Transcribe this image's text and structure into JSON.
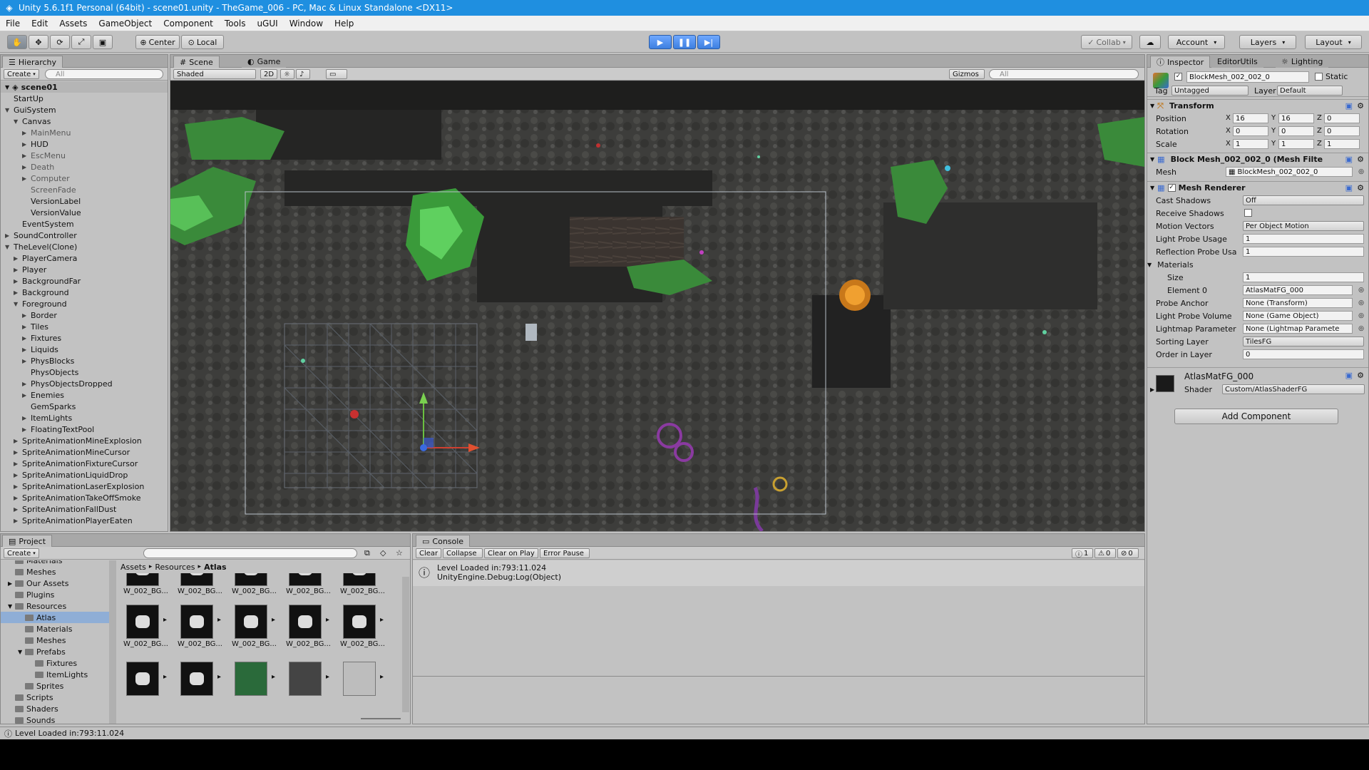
{
  "titlebar": {
    "title": "Unity 5.6.1f1 Personal (64bit) - scene01.unity - TheGame_006 - PC, Mac & Linux Standalone <DX11>"
  },
  "menu": [
    "File",
    "Edit",
    "Assets",
    "GameObject",
    "Component",
    "Tools",
    "uGUI",
    "Window",
    "Help"
  ],
  "toolbar": {
    "center": "Center",
    "local": "Local",
    "collab": "Collab",
    "account": "Account",
    "layers": "Layers",
    "layout": "Layout"
  },
  "hierarchy": {
    "tab": "Hierarchy",
    "create": "Create",
    "search": "All",
    "scene": "scene01",
    "items": [
      {
        "label": "StartUp",
        "depth": 1,
        "arrow": ""
      },
      {
        "label": "GuiSystem",
        "depth": 1,
        "arrow": "down"
      },
      {
        "label": "Canvas",
        "depth": 2,
        "arrow": "down"
      },
      {
        "label": "MainMenu",
        "depth": 3,
        "arrow": "right",
        "dim": true
      },
      {
        "label": "HUD",
        "depth": 3,
        "arrow": "right"
      },
      {
        "label": "EscMenu",
        "depth": 3,
        "arrow": "right",
        "dim": true
      },
      {
        "label": "Death",
        "depth": 3,
        "arrow": "right",
        "dim": true
      },
      {
        "label": "Computer",
        "depth": 3,
        "arrow": "right",
        "dim": true
      },
      {
        "label": "ScreenFade",
        "depth": 3,
        "arrow": "",
        "dim": true
      },
      {
        "label": "VersionLabel",
        "depth": 3,
        "arrow": ""
      },
      {
        "label": "VersionValue",
        "depth": 3,
        "arrow": ""
      },
      {
        "label": "EventSystem",
        "depth": 2,
        "arrow": ""
      },
      {
        "label": "SoundController",
        "depth": 1,
        "arrow": "right"
      },
      {
        "label": "TheLevel(Clone)",
        "depth": 1,
        "arrow": "down"
      },
      {
        "label": "PlayerCamera",
        "depth": 2,
        "arrow": "right"
      },
      {
        "label": "Player",
        "depth": 2,
        "arrow": "right"
      },
      {
        "label": "BackgroundFar",
        "depth": 2,
        "arrow": "right"
      },
      {
        "label": "Background",
        "depth": 2,
        "arrow": "right"
      },
      {
        "label": "Foreground",
        "depth": 2,
        "arrow": "down"
      },
      {
        "label": "Border",
        "depth": 3,
        "arrow": "right"
      },
      {
        "label": "Tiles",
        "depth": 3,
        "arrow": "right"
      },
      {
        "label": "Fixtures",
        "depth": 3,
        "arrow": "right"
      },
      {
        "label": "Liquids",
        "depth": 3,
        "arrow": "right"
      },
      {
        "label": "PhysBlocks",
        "depth": 3,
        "arrow": "right"
      },
      {
        "label": "PhysObjects",
        "depth": 3,
        "arrow": ""
      },
      {
        "label": "PhysObjectsDropped",
        "depth": 3,
        "arrow": "right"
      },
      {
        "label": "Enemies",
        "depth": 3,
        "arrow": "right"
      },
      {
        "label": "GemSparks",
        "depth": 3,
        "arrow": ""
      },
      {
        "label": "ItemLights",
        "depth": 3,
        "arrow": "right"
      },
      {
        "label": "FloatingTextPool",
        "depth": 3,
        "arrow": "right"
      },
      {
        "label": "SpriteAnimationMineExplosion",
        "depth": 2,
        "arrow": "right"
      },
      {
        "label": "SpriteAnimationMineCursor",
        "depth": 2,
        "arrow": "right"
      },
      {
        "label": "SpriteAnimationFixtureCursor",
        "depth": 2,
        "arrow": "right"
      },
      {
        "label": "SpriteAnimationLiquidDrop",
        "depth": 2,
        "arrow": "right"
      },
      {
        "label": "SpriteAnimationLaserExplosion",
        "depth": 2,
        "arrow": "right"
      },
      {
        "label": "SpriteAnimationTakeOffSmoke",
        "depth": 2,
        "arrow": "right"
      },
      {
        "label": "SpriteAnimationFallDust",
        "depth": 2,
        "arrow": "right"
      },
      {
        "label": "SpriteAnimationPlayerEaten",
        "depth": 2,
        "arrow": "right"
      }
    ]
  },
  "scene": {
    "tab_scene": "Scene",
    "tab_game": "Game",
    "shading": "Shaded",
    "mode2d": "2D",
    "gizmos": "Gizmos",
    "search": "All"
  },
  "inspector": {
    "tabs": [
      "Inspector",
      "EditorUtils",
      "Lighting"
    ],
    "object_name": "BlockMesh_002_002_0",
    "static": "Static",
    "tag_label": "Tag",
    "tag": "Untagged",
    "layer_label": "Layer",
    "layer": "Default",
    "transform": {
      "title": "Transform",
      "rows": [
        {
          "label": "Position",
          "x": "16",
          "y": "16",
          "z": "0"
        },
        {
          "label": "Rotation",
          "x": "0",
          "y": "0",
          "z": "0"
        },
        {
          "label": "Scale",
          "x": "1",
          "y": "1",
          "z": "1"
        }
      ]
    },
    "meshfilter": {
      "title": "Block Mesh_002_002_0 (Mesh Filte",
      "mesh_label": "Mesh",
      "mesh": "BlockMesh_002_002_0"
    },
    "renderer": {
      "title": "Mesh Renderer",
      "rows": [
        {
          "label": "Cast Shadows",
          "value": "Off",
          "kind": "dd"
        },
        {
          "label": "Receive Shadows",
          "value": "",
          "kind": "check"
        },
        {
          "label": "Motion Vectors",
          "value": "Per Object Motion",
          "kind": "dd"
        },
        {
          "label": "Light Probe Usage",
          "value": "1",
          "kind": "field"
        },
        {
          "label": "Reflection Probe Usa",
          "value": "1",
          "kind": "field"
        },
        {
          "label": "Materials",
          "value": "",
          "kind": "header"
        },
        {
          "label": "Size",
          "value": "1",
          "kind": "field",
          "indent": 1
        },
        {
          "label": "Element 0",
          "value": "AtlasMatFG_000",
          "kind": "obj",
          "indent": 1
        },
        {
          "label": "Probe Anchor",
          "value": "None (Transform)",
          "kind": "obj"
        },
        {
          "label": "Light Probe Volume",
          "value": "None (Game Object)",
          "kind": "obj"
        },
        {
          "label": "Lightmap Parameter",
          "value": "None (Lightmap Paramete",
          "kind": "obj"
        },
        {
          "label": "Sorting Layer",
          "value": "TilesFG",
          "kind": "dd"
        },
        {
          "label": "Order in Layer",
          "value": "0",
          "kind": "field"
        }
      ]
    },
    "material": {
      "name": "AtlasMatFG_000",
      "shader_label": "Shader",
      "shader": "Custom/AtlasShaderFG"
    },
    "add_component": "Add Component"
  },
  "project": {
    "tab": "Project",
    "create": "Create",
    "tree": [
      {
        "label": "Materials",
        "depth": 1,
        "arrow": ""
      },
      {
        "label": "Meshes",
        "depth": 1,
        "arrow": ""
      },
      {
        "label": "Our Assets",
        "depth": 1,
        "arrow": "right"
      },
      {
        "label": "Plugins",
        "depth": 1,
        "arrow": ""
      },
      {
        "label": "Resources",
        "depth": 1,
        "arrow": "down"
      },
      {
        "label": "Atlas",
        "depth": 2,
        "arrow": "",
        "selected": true
      },
      {
        "label": "Materials",
        "depth": 2,
        "arrow": ""
      },
      {
        "label": "Meshes",
        "depth": 2,
        "arrow": ""
      },
      {
        "label": "Prefabs",
        "depth": 2,
        "arrow": "down"
      },
      {
        "label": "Fixtures",
        "depth": 3,
        "arrow": ""
      },
      {
        "label": "ItemLights",
        "depth": 3,
        "arrow": ""
      },
      {
        "label": "Sprites",
        "depth": 2,
        "arrow": ""
      },
      {
        "label": "Scripts",
        "depth": 1,
        "arrow": ""
      },
      {
        "label": "Shaders",
        "depth": 1,
        "arrow": ""
      },
      {
        "label": "Sounds",
        "depth": 1,
        "arrow": ""
      }
    ],
    "breadcrumb": [
      "Assets",
      "Resources",
      "Atlas"
    ],
    "thumb_labels": [
      "W_002_BG...",
      "W_002_BG...",
      "W_002_BG...",
      "W_002_BG...",
      "W_002_BG..."
    ]
  },
  "console": {
    "tab": "Console",
    "buttons": [
      "Clear",
      "Collapse",
      "Clear on Play",
      "Error Pause"
    ],
    "counts": {
      "info": "1",
      "warn": "0",
      "error": "0"
    },
    "log_line1": "Level Loaded in:793:11.024",
    "log_line2": "UnityEngine.Debug:Log(Object)"
  },
  "status": "Level Loaded in:793:11.024"
}
